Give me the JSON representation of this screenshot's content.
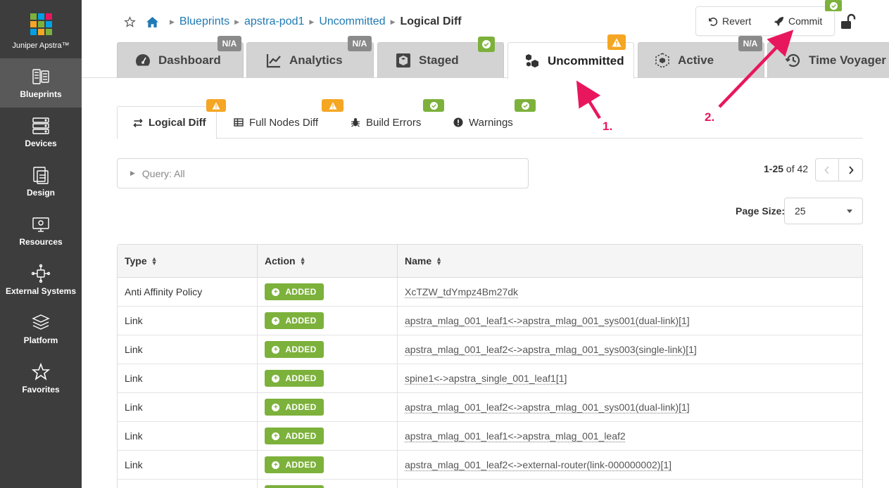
{
  "sidebar": {
    "brand": "Juniper Apstra™",
    "logo_colors": [
      "#7cb13b",
      "#00a0e3",
      "#e8175d",
      "#f5a623",
      "#7cb13b",
      "#00a0e3",
      "#00a0e3",
      "#f5a623",
      "#7cb13b"
    ],
    "items": [
      {
        "label": "Blueprints",
        "icon": "blueprints-icon",
        "active": true
      },
      {
        "label": "Devices",
        "icon": "devices-icon"
      },
      {
        "label": "Design",
        "icon": "design-icon"
      },
      {
        "label": "Resources",
        "icon": "resources-icon"
      },
      {
        "label": "External Systems",
        "icon": "external-systems-icon"
      },
      {
        "label": "Platform",
        "icon": "platform-icon"
      },
      {
        "label": "Favorites",
        "icon": "star-icon"
      }
    ]
  },
  "breadcrumb": {
    "items": [
      "Blueprints",
      "apstra-pod1",
      "Uncommitted"
    ],
    "current": "Logical Diff"
  },
  "actions": {
    "revert": "Revert",
    "commit": "Commit"
  },
  "main_tabs": [
    {
      "label": "Dashboard",
      "badge": "N/A",
      "icon": "gauge-icon"
    },
    {
      "label": "Analytics",
      "badge": "N/A",
      "icon": "chart-line-icon"
    },
    {
      "label": "Staged",
      "badge": "ok",
      "icon": "staged-cube-icon"
    },
    {
      "label": "Uncommitted",
      "badge": "warning",
      "icon": "cubes-icon",
      "active": true
    },
    {
      "label": "Active",
      "badge": "N/A",
      "icon": "active-cube-icon"
    },
    {
      "label": "Time Voyager",
      "icon": "history-icon"
    }
  ],
  "sub_tabs": [
    {
      "label": "Logical Diff",
      "badge": "warning",
      "icon": "exchange-icon",
      "active": true
    },
    {
      "label": "Full Nodes Diff",
      "badge": "warning",
      "icon": "table-icon"
    },
    {
      "label": "Build Errors",
      "badge": "ok",
      "icon": "bug-icon"
    },
    {
      "label": "Warnings",
      "badge": "ok",
      "icon": "exclamation-circle-icon"
    }
  ],
  "query": {
    "label": "Query: All"
  },
  "pagination": {
    "range": "1-25",
    "of_label": "of",
    "total": "42",
    "page_size_label": "Page Size:",
    "page_size": "25"
  },
  "table": {
    "columns": [
      "Type",
      "Action",
      "Name"
    ],
    "action_label": "ADDED",
    "rows": [
      {
        "type": "Anti Affinity Policy",
        "action": "ADDED",
        "name": "XcTZW_tdYmpz4Bm27dk"
      },
      {
        "type": "Link",
        "action": "ADDED",
        "name": "apstra_mlag_001_leaf1<->apstra_mlag_001_sys001(dual-link)[1]"
      },
      {
        "type": "Link",
        "action": "ADDED",
        "name": "apstra_mlag_001_leaf2<->apstra_mlag_001_sys003(single-link)[1]"
      },
      {
        "type": "Link",
        "action": "ADDED",
        "name": "spine1<->apstra_single_001_leaf1[1]"
      },
      {
        "type": "Link",
        "action": "ADDED",
        "name": "apstra_mlag_001_leaf2<->apstra_mlag_001_sys001(dual-link)[1]"
      },
      {
        "type": "Link",
        "action": "ADDED",
        "name": "apstra_mlag_001_leaf1<->apstra_mlag_001_leaf2"
      },
      {
        "type": "Link",
        "action": "ADDED",
        "name": "apstra_mlag_001_leaf2<->external-router(link-000000002)[1]"
      },
      {
        "type": "",
        "action": "ADDED",
        "name": ""
      }
    ]
  },
  "annotations": {
    "step1": "1.",
    "step2": "2.",
    "color": "#e8175d"
  }
}
